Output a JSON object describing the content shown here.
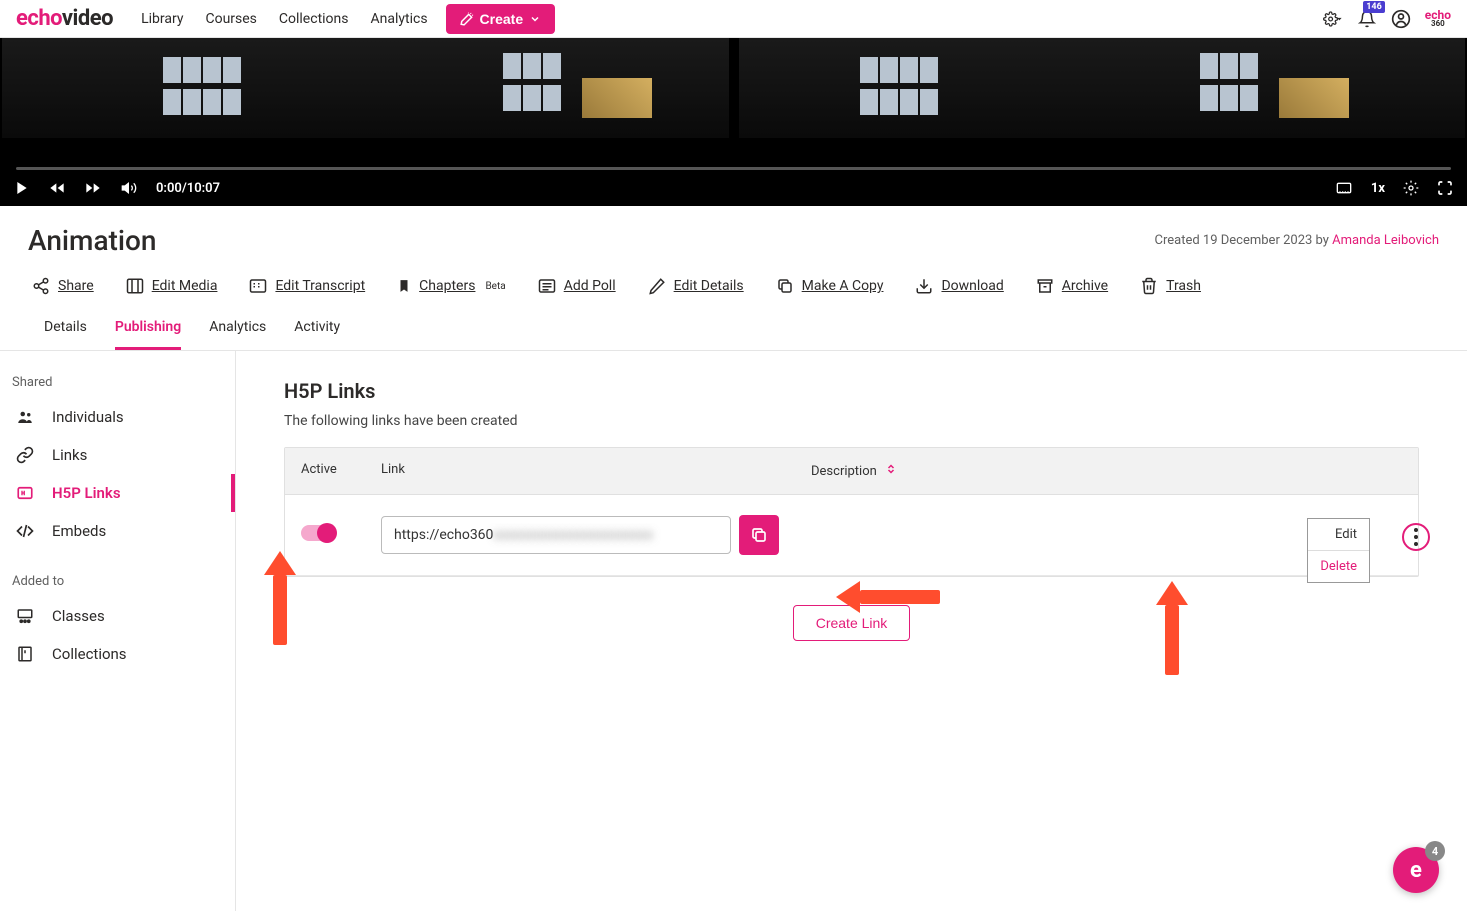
{
  "brand": {
    "part1": "echo",
    "part2": "video"
  },
  "nav": {
    "library": "Library",
    "courses": "Courses",
    "collections": "Collections",
    "analytics": "Analytics",
    "create": "Create"
  },
  "notifications": {
    "count": "146"
  },
  "player": {
    "time": "0:00/10:07",
    "speed": "1x"
  },
  "page": {
    "title": "Animation",
    "created_prefix": "Created 19 December 2023 by ",
    "author": "Amanda Leibovich"
  },
  "actions": {
    "share": "Share",
    "edit_media": "Edit Media",
    "edit_transcript": "Edit Transcript",
    "chapters": "Chapters",
    "chapters_badge": "Beta",
    "add_poll": "Add Poll",
    "edit_details": "Edit Details",
    "make_copy": "Make A Copy",
    "download": "Download",
    "archive": "Archive",
    "trash": "Trash"
  },
  "tabs": {
    "details": "Details",
    "publishing": "Publishing",
    "analytics": "Analytics",
    "activity": "Activity"
  },
  "sidebar": {
    "shared": "Shared",
    "individuals": "Individuals",
    "links": "Links",
    "h5p": "H5P Links",
    "embeds": "Embeds",
    "added_to": "Added to",
    "classes": "Classes",
    "collections": "Collections"
  },
  "panel": {
    "title": "H5P Links",
    "subtitle": "The following links have been created",
    "cols": {
      "active": "Active",
      "link": "Link",
      "description": "Description"
    },
    "row1": {
      "url": "https://echo360"
    },
    "create_link": "Create Link",
    "menu": {
      "edit": "Edit",
      "delete": "Delete"
    }
  },
  "float": {
    "count": "4",
    "letter": "e"
  }
}
